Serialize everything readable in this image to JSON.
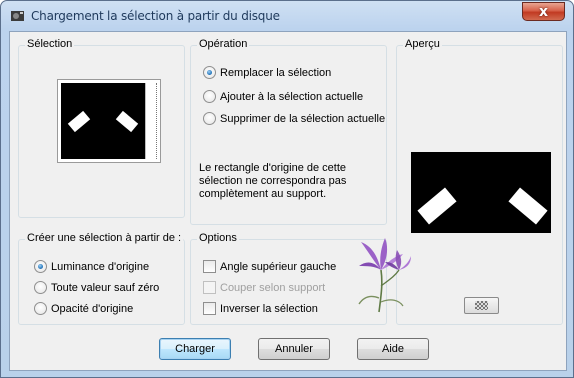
{
  "window": {
    "title": "Chargement la sélection à partir du disque",
    "close_symbol": "x"
  },
  "selection_group": {
    "label": "Sélection"
  },
  "operation_group": {
    "label": "Opération",
    "options": [
      {
        "label": "Remplacer la sélection",
        "checked": true
      },
      {
        "label": "Ajouter à la sélection actuelle",
        "checked": false
      },
      {
        "label": "Supprimer de la sélection actuelle",
        "checked": false
      }
    ],
    "info": "Le rectangle d'origine de cette sélection ne correspondra pas complètement au support."
  },
  "preview_group": {
    "label": "Aperçu",
    "toggle_icon": "checkerboard-icon"
  },
  "create_group": {
    "label": "Créer une sélection à partir de :",
    "options": [
      {
        "label": "Luminance d'origine",
        "checked": true
      },
      {
        "label": "Toute valeur sauf zéro",
        "checked": false
      },
      {
        "label": "Opacité d'origine",
        "checked": false
      }
    ]
  },
  "options_group": {
    "label": "Options",
    "items": [
      {
        "label": "Angle supérieur gauche",
        "checked": false,
        "enabled": true
      },
      {
        "label": "Couper selon support",
        "checked": false,
        "enabled": false
      },
      {
        "label": "Inverser la sélection",
        "checked": false,
        "enabled": true
      }
    ]
  },
  "buttons": {
    "load": "Charger",
    "cancel": "Annuler",
    "help": "Aide"
  },
  "colors": {
    "accent": "#3c7fb1",
    "close": "#c13a22",
    "flower": "#8a4fb6"
  }
}
